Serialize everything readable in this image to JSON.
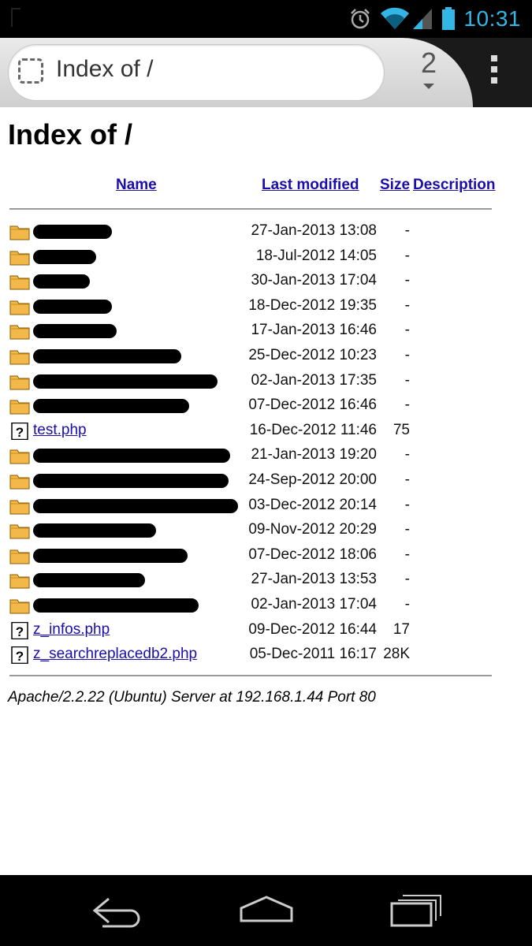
{
  "status_bar": {
    "time": "10:31"
  },
  "browser": {
    "omnibox_title": "Index of /",
    "tab_count": "2"
  },
  "page": {
    "heading": "Index of /",
    "columns": {
      "name": "Name",
      "last_modified": "Last modified",
      "size": "Size",
      "description": "Description"
    },
    "rows": [
      {
        "type": "folder",
        "name": "",
        "modified": "27-Jan-2013 13:08",
        "size": "-"
      },
      {
        "type": "folder",
        "name": "",
        "modified": "18-Jul-2012 14:05",
        "size": "-"
      },
      {
        "type": "folder",
        "name": "",
        "modified": "30-Jan-2013 17:04",
        "size": "-"
      },
      {
        "type": "folder",
        "name": "",
        "modified": "18-Dec-2012 19:35",
        "size": "-"
      },
      {
        "type": "folder",
        "name": "",
        "modified": "17-Jan-2013 16:46",
        "size": "-"
      },
      {
        "type": "folder",
        "name": "",
        "modified": "25-Dec-2012 10:23",
        "size": "-"
      },
      {
        "type": "folder",
        "name": "",
        "modified": "02-Jan-2013 17:35",
        "size": "-"
      },
      {
        "type": "folder",
        "name": "",
        "modified": "07-Dec-2012 16:46",
        "size": "-"
      },
      {
        "type": "file",
        "name": "test.php",
        "modified": "16-Dec-2012 11:46",
        "size": "75"
      },
      {
        "type": "folder",
        "name": "",
        "modified": "21-Jan-2013 19:20",
        "size": "-"
      },
      {
        "type": "folder",
        "name": "",
        "modified": "24-Sep-2012 20:00",
        "size": "-"
      },
      {
        "type": "folder",
        "name": "",
        "modified": "03-Dec-2012 20:14",
        "size": "-"
      },
      {
        "type": "folder",
        "name": "",
        "modified": "09-Nov-2012 20:29",
        "size": "-"
      },
      {
        "type": "folder",
        "name": "",
        "modified": "07-Dec-2012 18:06",
        "size": "-"
      },
      {
        "type": "folder",
        "name": "",
        "modified": "27-Jan-2013 13:53",
        "size": "-"
      },
      {
        "type": "folder",
        "name": "",
        "modified": "02-Jan-2013 17:04",
        "size": "-"
      },
      {
        "type": "file",
        "name": "z_infos.php",
        "modified": "09-Dec-2012 16:44",
        "size": "17"
      },
      {
        "type": "file",
        "name": "z_searchreplacedb2.php",
        "modified": "05-Dec-2011 16:17",
        "size": "28K"
      }
    ],
    "footer": "Apache/2.2.22 (Ubuntu) Server at 192.168.1.44 Port 80"
  },
  "icons": {
    "status": [
      "alarm-icon",
      "wifi-icon",
      "signal-icon",
      "battery-icon"
    ],
    "browser": [
      "page-icon",
      "overflow-menu-icon"
    ],
    "navigation": [
      "back-icon",
      "home-icon",
      "recent-apps-icon"
    ]
  },
  "colors": {
    "link": "#1a0dab",
    "status_accent": "#33b5e5",
    "folder": "#f2b94a"
  }
}
